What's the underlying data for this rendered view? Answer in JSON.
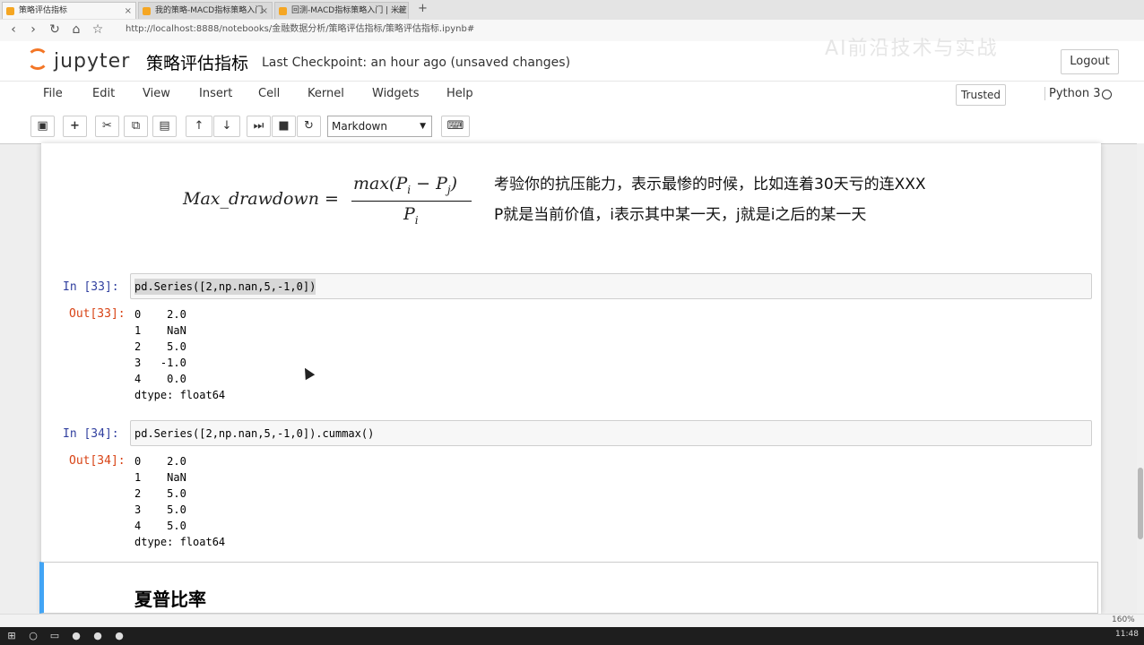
{
  "browser": {
    "tabs": [
      {
        "label": "策略评估指标",
        "active": true
      },
      {
        "label": "我的策略-MACD指标策略入门",
        "active": false
      },
      {
        "label": "回测-MACD指标策略入门 | 米筐",
        "active": false
      }
    ],
    "new_tab": "+",
    "url": "http://localhost:8888/notebooks/金融数据分析/策略评估指标/策略评估指标.ipynb#"
  },
  "jupyter": {
    "logo_text": "jupyter",
    "notebook_title": "策略评估指标",
    "checkpoint": "Last Checkpoint: an hour ago (unsaved changes)",
    "logout": "Logout",
    "menu": [
      "File",
      "Edit",
      "View",
      "Insert",
      "Cell",
      "Kernel",
      "Widgets",
      "Help"
    ],
    "trusted": "Trusted",
    "kernel": "Python 3",
    "cell_type": "Markdown",
    "toolbar_icons": [
      "save-icon",
      "plus-icon",
      "cut-icon",
      "copy-icon",
      "paste-icon",
      "arrow-up-icon",
      "arrow-down-icon",
      "run-icon",
      "stop-icon",
      "restart-icon",
      "keyboard-icon"
    ]
  },
  "notebook": {
    "formula": {
      "lhs": "Max_drawdown =",
      "numerator": "max(P",
      "numerator_sub_i": "i",
      "numerator_mid": " − P",
      "numerator_sub_j": "j",
      "numerator_end": ")",
      "denominator": "P",
      "denominator_sub": "i"
    },
    "explain_line1": "考验你的抗压能力，表示最惨的时候，比如连着30天亏的连XXX",
    "explain_line2": "P就是当前价值，i表示其中某一天，j就是i之后的某一天",
    "cells": [
      {
        "in_prompt": "In  [33]:",
        "code": "pd.Series([2,np.nan,5,-1,0])",
        "out_prompt": "Out[33]:",
        "output": [
          "0    2.0",
          "1    NaN",
          "2    5.0",
          "3   -1.0",
          "4    0.0",
          "dtype: float64"
        ]
      },
      {
        "in_prompt": "In  [34]:",
        "code": "pd.Series([2,np.nan,5,-1,0]).cummax()",
        "out_prompt": "Out[34]:",
        "output": [
          "0    2.0",
          "1    NaN",
          "2    5.0",
          "3    5.0",
          "4    5.0",
          "dtype: float64"
        ]
      }
    ],
    "markdown_heading": "夏普比率"
  },
  "taskbar": {
    "clock": "11:48",
    "zoom": "160%"
  }
}
